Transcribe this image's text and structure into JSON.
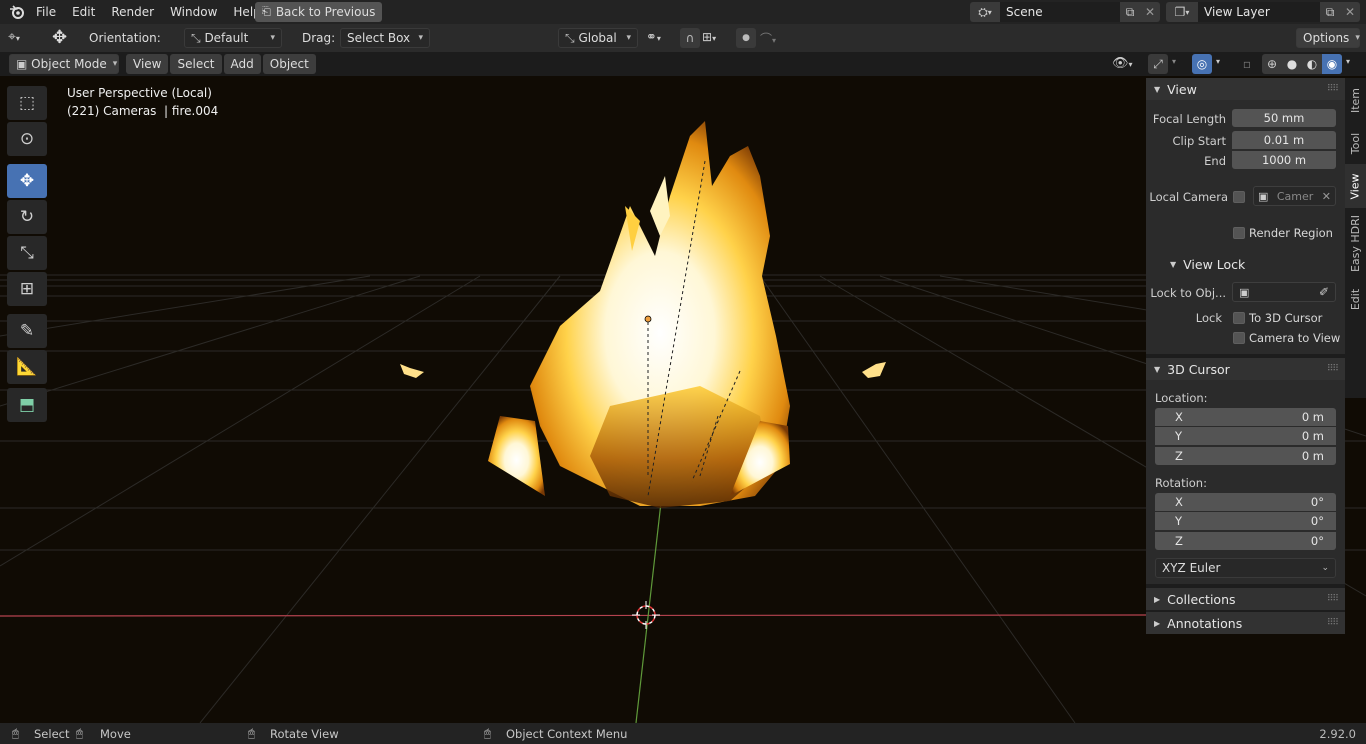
{
  "topbar": {
    "menus": [
      "File",
      "Edit",
      "Render",
      "Window",
      "Help"
    ],
    "back_button": "Back to Previous",
    "scene": "Scene",
    "view_layer": "View Layer"
  },
  "tool_header": {
    "orientation_label": "Orientation:",
    "orientation_value": "Default",
    "drag_label": "Drag:",
    "drag_value": "Select Box",
    "transform_orientation": "Global",
    "options": "Options"
  },
  "view_header": {
    "mode": "Object Mode",
    "menus": [
      "View",
      "Select",
      "Add",
      "Object"
    ]
  },
  "viewport": {
    "perspective_label": "User Perspective (Local)",
    "object_info": "(221) Cameras  | fire.004"
  },
  "toolbar": {
    "tools": [
      "select-box-icon",
      "cursor-icon",
      "move-icon",
      "rotate-icon",
      "scale-icon",
      "transform-icon",
      "annotate-icon",
      "measure-icon",
      "add-cube-icon"
    ],
    "active": "move-icon"
  },
  "npanel": {
    "tabs": [
      "Item",
      "Tool",
      "View",
      "Easy HDRI",
      "Edit"
    ],
    "active_tab": "View",
    "view": {
      "title": "View",
      "focal_length_label": "Focal Length",
      "focal_length": "50 mm",
      "clip_start_label": "Clip Start",
      "clip_start": "0.01 m",
      "end_label": "End",
      "end": "1000 m",
      "local_camera_label": "Local Camera",
      "local_camera_value": "Camer",
      "render_region_label": "Render Region"
    },
    "view_lock": {
      "title": "View Lock",
      "lock_to_obj_label": "Lock to Obj...",
      "lock_label": "Lock",
      "to_3d_cursor": "To 3D Cursor",
      "camera_to_view": "Camera to View"
    },
    "cursor": {
      "title": "3D Cursor",
      "location_label": "Location:",
      "rotation_label": "Rotation:",
      "location": [
        {
          "axis": "X",
          "value": "0 m"
        },
        {
          "axis": "Y",
          "value": "0 m"
        },
        {
          "axis": "Z",
          "value": "0 m"
        }
      ],
      "rotation": [
        {
          "axis": "X",
          "value": "0°"
        },
        {
          "axis": "Y",
          "value": "0°"
        },
        {
          "axis": "Z",
          "value": "0°"
        }
      ],
      "rotation_mode": "XYZ Euler"
    },
    "collections": "Collections",
    "annotations": "Annotations"
  },
  "statusbar": {
    "select": "Select",
    "move": "Move",
    "rotate_view": "Rotate View",
    "context_menu": "Object Context Menu",
    "version": "2.92.0"
  },
  "colors": {
    "accent": "#4772b3",
    "viewport_bg": "#100b04",
    "x_axis": "#b5434f",
    "y_axis": "#5f9a3a"
  }
}
